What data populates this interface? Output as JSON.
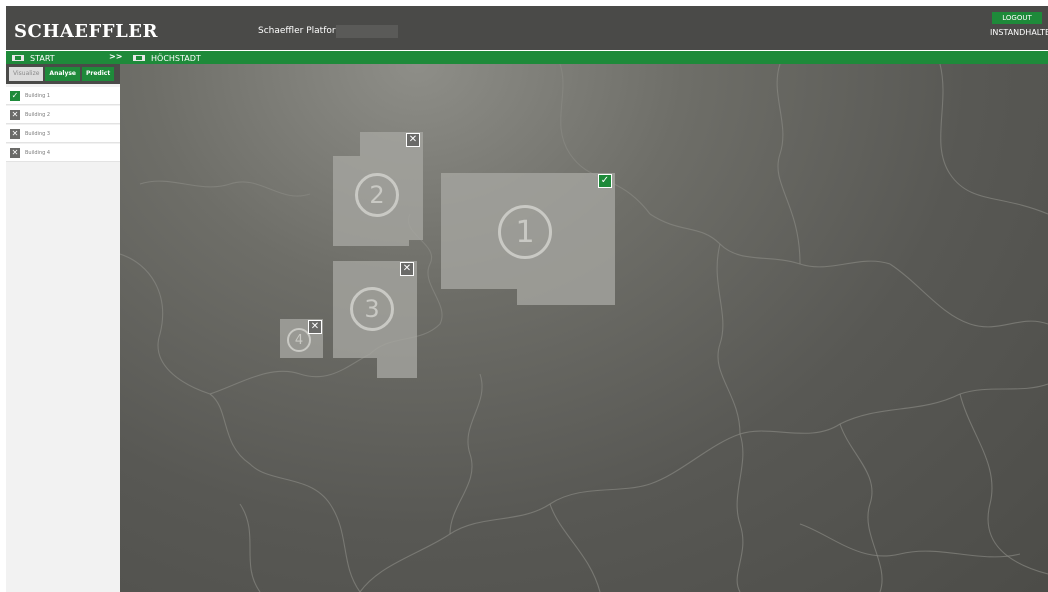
{
  "header": {
    "logo": "SCHAEFFLER",
    "platform_title": "Schaeffler Platform",
    "logout_label": "LOGOUT",
    "user_name": "INSTANDHALTER"
  },
  "breadcrumb": {
    "start_label": "START",
    "separator": ">>",
    "current_label": "HÖCHSTADT"
  },
  "sidebar": {
    "tabs": [
      {
        "label": "Visualize",
        "active": true
      },
      {
        "label": "Analyse",
        "active": false
      },
      {
        "label": "Predict",
        "active": false
      }
    ],
    "buildings": [
      {
        "label": "Building 1",
        "checked": true
      },
      {
        "label": "Building 2",
        "checked": false
      },
      {
        "label": "Building 3",
        "checked": false
      },
      {
        "label": "Building 4",
        "checked": false
      }
    ]
  },
  "map": {
    "buildings": [
      {
        "number": "1",
        "selected": true
      },
      {
        "number": "2",
        "selected": false
      },
      {
        "number": "3",
        "selected": false
      },
      {
        "number": "4",
        "selected": false
      }
    ]
  },
  "colors": {
    "brand_green": "#1e8a3a",
    "header_gray": "#4a4a48",
    "map_gray": "#585854"
  }
}
